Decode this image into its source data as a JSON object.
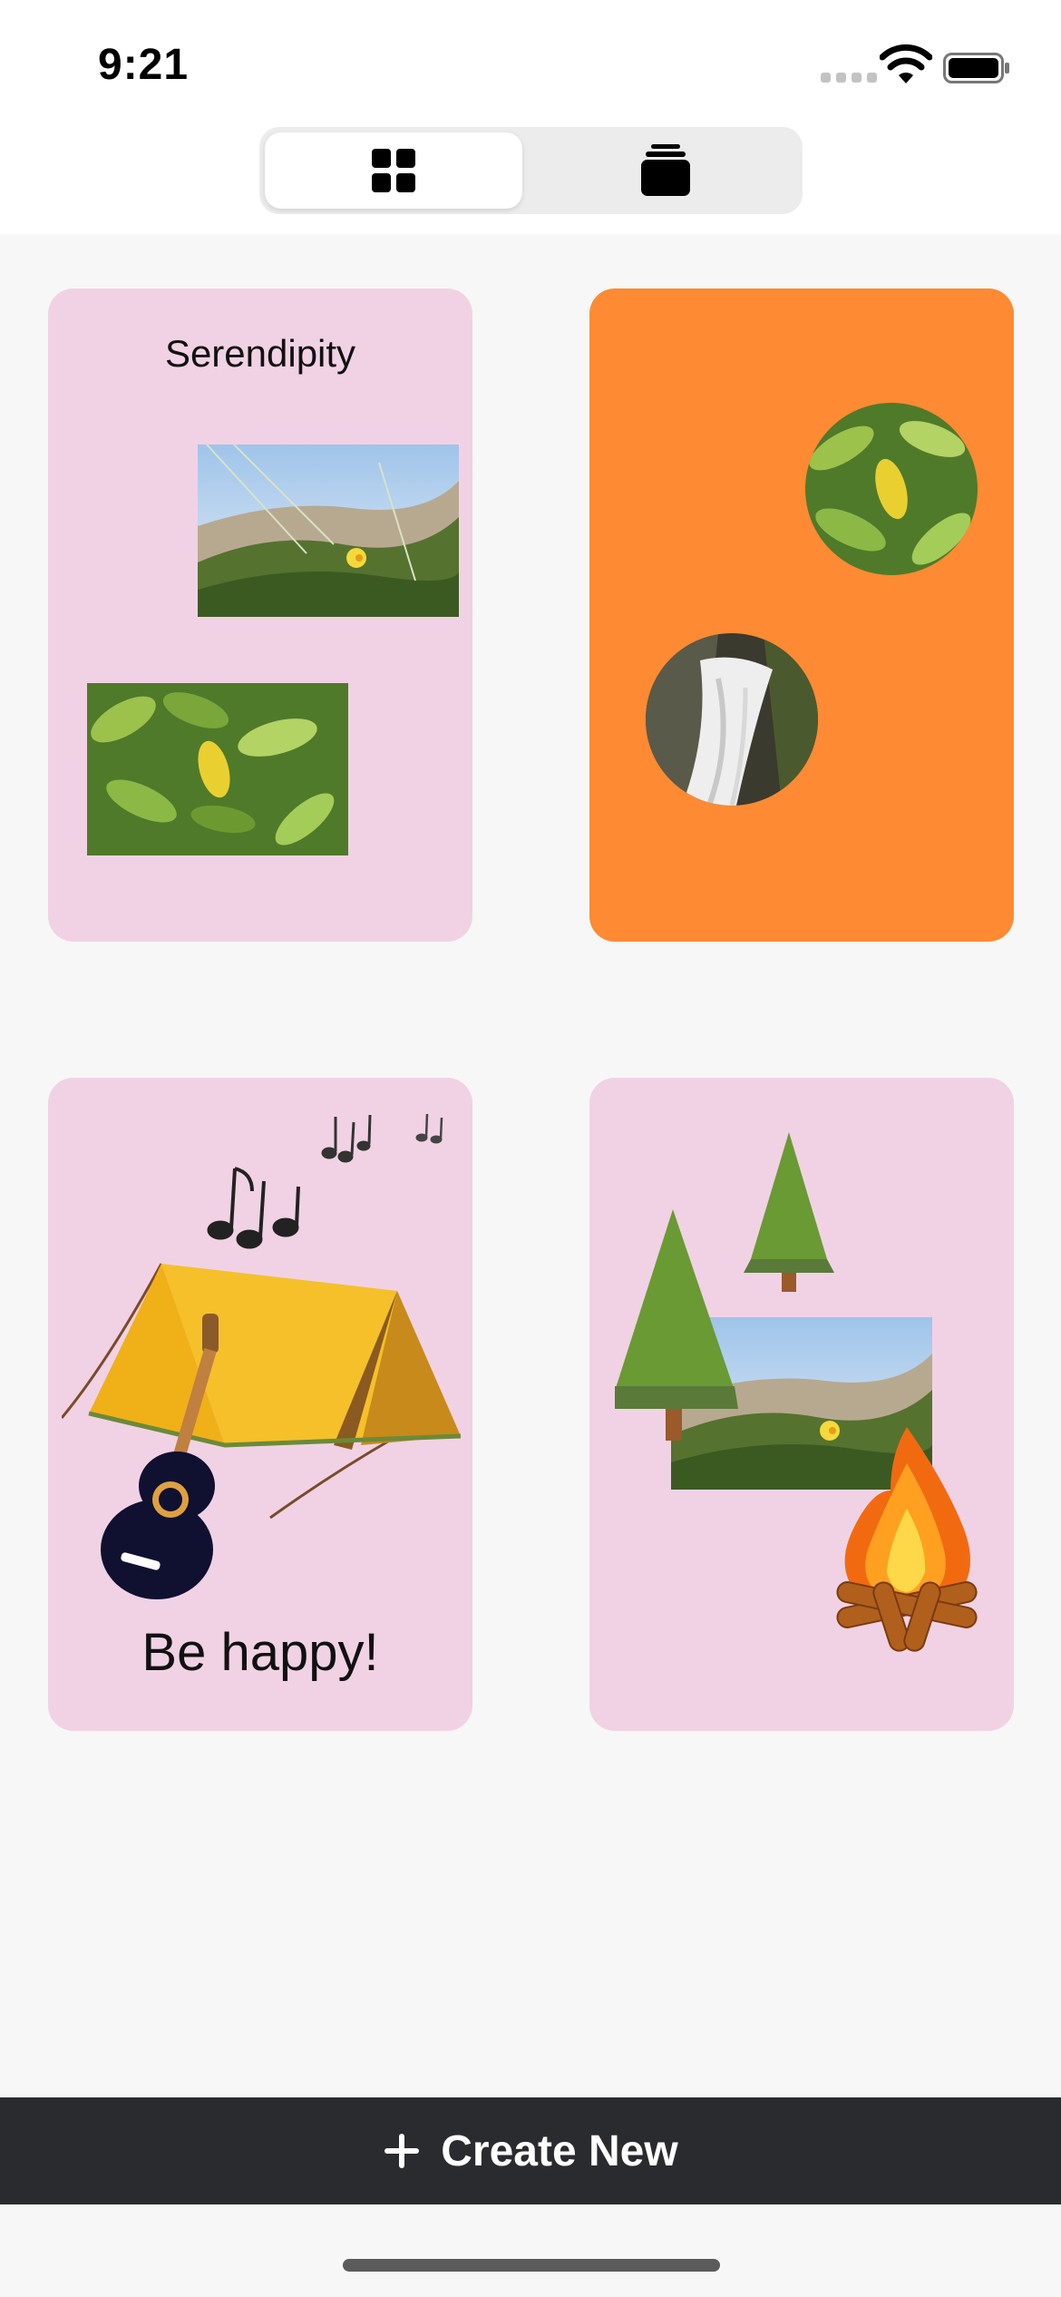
{
  "status_bar": {
    "time": "9:21"
  },
  "view_switcher": {
    "options": [
      "grid-view",
      "stack-view"
    ],
    "selected": "grid-view"
  },
  "cards": [
    {
      "title": "Serendipity",
      "background": "#f1d2e4"
    },
    {
      "title": "",
      "background": "#fe8a33"
    },
    {
      "title": "Be happy!",
      "background": "#f1d2e4"
    },
    {
      "title": "",
      "background": "#f1d2e4"
    }
  ],
  "create_button": {
    "label": "Create New",
    "icon": "plus-icon"
  },
  "colors": {
    "pink": "#f1d2e4",
    "orange": "#fe8a33",
    "bottom_bar": "#2a2b2f",
    "tree_green": "#6a9a33"
  }
}
